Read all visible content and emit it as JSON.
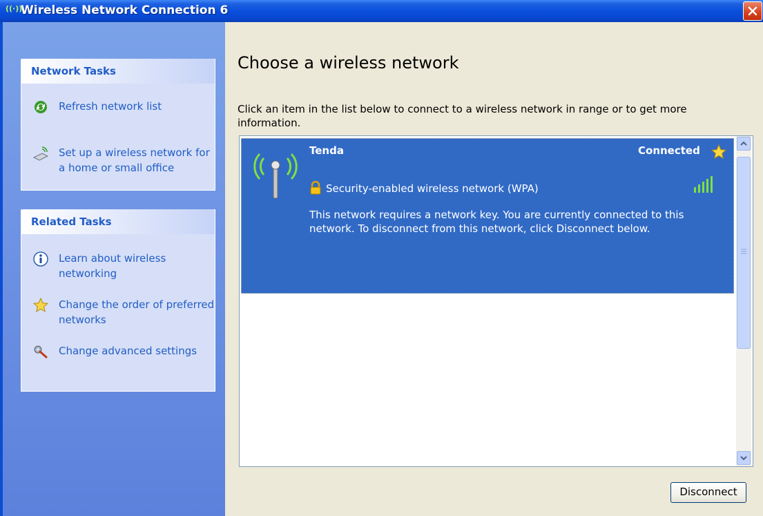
{
  "window": {
    "title": "Wireless Network Connection 6",
    "title_icon": "((·))"
  },
  "sidebar": {
    "network_tasks": {
      "header": "Network Tasks",
      "items": [
        {
          "label": "Refresh network list",
          "icon": "refresh-icon"
        },
        {
          "label": "Set up a wireless network for a home or small office",
          "icon": "wireless-setup-icon"
        }
      ]
    },
    "related_tasks": {
      "header": "Related Tasks",
      "items": [
        {
          "label": "Learn about wireless networking",
          "icon": "info-icon"
        },
        {
          "label": "Change the order of preferred networks",
          "icon": "star-icon"
        },
        {
          "label": "Change advanced settings",
          "icon": "tools-icon"
        }
      ]
    }
  },
  "main": {
    "heading": "Choose a wireless network",
    "intro": "Click an item in the list below to connect to a wireless network in range or to get more information.",
    "networks": [
      {
        "name": "Tenda",
        "status": "Connected",
        "security": "Security-enabled wireless network (WPA)",
        "description": "This network requires a network key. You are currently connected to this network. To disconnect from this network, click Disconnect below.",
        "signal_bars": 5
      }
    ],
    "disconnect_label": "Disconnect"
  },
  "colors": {
    "accent": "#316ac5",
    "sidebar_link": "#215dc6",
    "title_bar": "#0a4fdc"
  }
}
